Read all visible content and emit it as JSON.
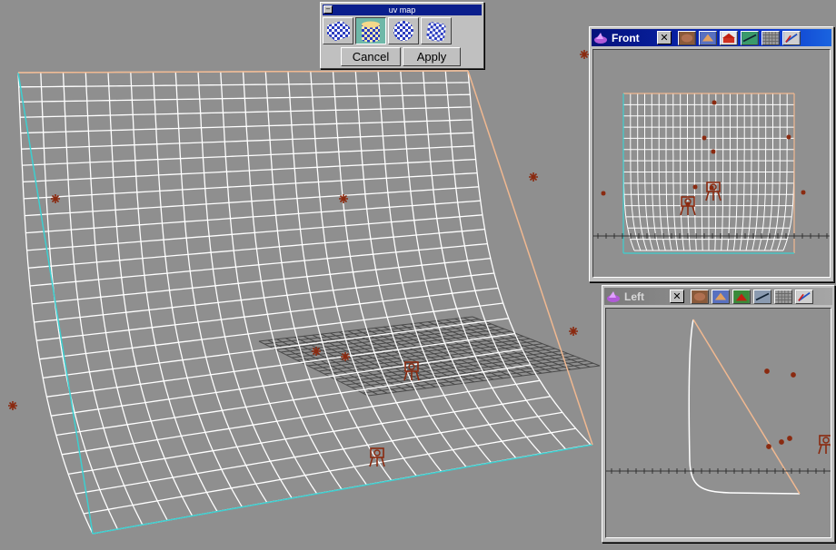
{
  "uv_dialog": {
    "title": "uv map",
    "minimize_glyph": "–",
    "projections": [
      "planar-projection-icon",
      "cylindrical-projection-icon",
      "spherical-projection-icon",
      "cubic-projection-icon"
    ],
    "selected_projection": 1,
    "cancel_label": "Cancel",
    "apply_label": "Apply"
  },
  "front_view": {
    "title": "Front",
    "close_glyph": "✕",
    "toolbar_icons": [
      "textured-view-icon",
      "lit-view-icon",
      "render-view-icon",
      "wireframe-mode-icon",
      "grid-view-icon",
      "axis-view-icon"
    ]
  },
  "left_view": {
    "title": "Left",
    "close_glyph": "✕",
    "toolbar_icons": [
      "textured-view-icon",
      "lit-view-icon",
      "render-view-icon",
      "wireframe-mode-icon",
      "grid-view-icon",
      "axis-view-icon"
    ]
  },
  "colors": {
    "mesh": "#ffffff",
    "accent_cyan": "#3ccfd0",
    "accent_peach": "#f0b890",
    "light_marker": "#8a2a10",
    "viewport_bg": "#8f8f8f"
  }
}
